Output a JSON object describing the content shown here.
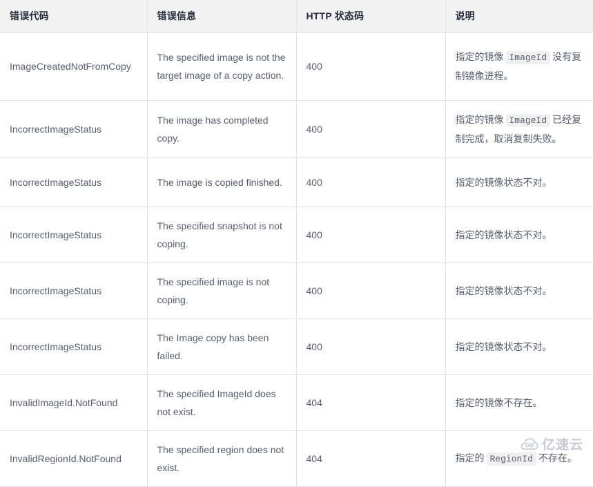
{
  "table": {
    "columns": [
      {
        "key": "code",
        "label": "错误代码"
      },
      {
        "key": "msg",
        "label": "错误信息"
      },
      {
        "key": "http",
        "label": "HTTP 状态码"
      },
      {
        "key": "desc",
        "label": "说明"
      }
    ],
    "rows": [
      {
        "code": "ImageCreatedNotFromCopy",
        "msg": "The specified image is not the target image of a copy action.",
        "http": "400",
        "desc_pre": "指定的镜像",
        "desc_code": "ImageId",
        "desc_post": "没有复制镜像进程。"
      },
      {
        "code": "IncorrectImageStatus",
        "msg": "The image has completed copy.",
        "http": "400",
        "desc_pre": "指定的镜像",
        "desc_code": "ImageId",
        "desc_post": "已经复制完成，取消复制失败。"
      },
      {
        "code": "IncorrectImageStatus",
        "msg": "The image is copied finished.",
        "http": "400",
        "desc_pre": "指定的镜像状态不对。",
        "desc_code": "",
        "desc_post": ""
      },
      {
        "code": "IncorrectImageStatus",
        "msg": "The specified snapshot is not coping.",
        "http": "400",
        "desc_pre": "指定的镜像状态不对。",
        "desc_code": "",
        "desc_post": ""
      },
      {
        "code": "IncorrectImageStatus",
        "msg": "The specified image is not coping.",
        "http": "400",
        "desc_pre": "指定的镜像状态不对。",
        "desc_code": "",
        "desc_post": ""
      },
      {
        "code": "IncorrectImageStatus",
        "msg": "The Image copy has been failed.",
        "http": "400",
        "desc_pre": "指定的镜像状态不对。",
        "desc_code": "",
        "desc_post": ""
      },
      {
        "code": "InvalidImageId.NotFound",
        "msg": "The specified ImageId does not exist.",
        "http": "404",
        "desc_pre": "指定的镜像不存在。",
        "desc_code": "",
        "desc_post": ""
      },
      {
        "code": "InvalidRegionId.NotFound",
        "msg": "The specified region does not exist.",
        "http": "404",
        "desc_pre": "指定的",
        "desc_code": "RegionId",
        "desc_post": "不存在。"
      }
    ]
  },
  "watermark": {
    "text": "亿速云",
    "icon": "cloud-icon",
    "color": "#9aa0ae"
  },
  "colors": {
    "header_bg": "#f2f2f2",
    "border": "#e3e3e3",
    "header_text": "#252b3a",
    "body_text": "#575d6c",
    "code_bg": "#f0f0f0"
  }
}
